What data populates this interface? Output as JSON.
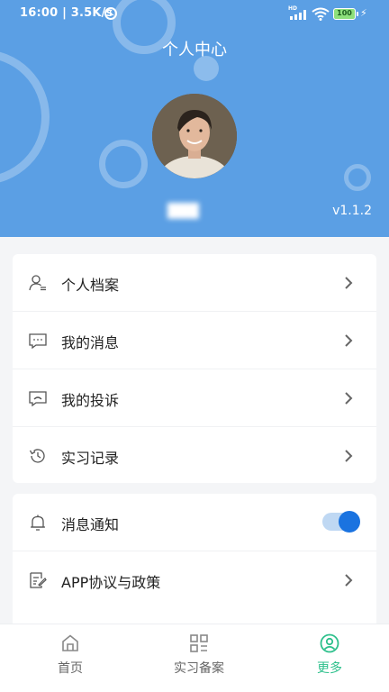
{
  "status_bar": {
    "time_speed": "16:00 | 3.5K/s",
    "network_badge": "HD",
    "battery_level": "100",
    "icons": [
      "alarm-icon",
      "signal-icon",
      "wifi-icon",
      "battery-icon",
      "charging-icon"
    ]
  },
  "header": {
    "title": "个人中心",
    "username": "███",
    "version": "v1.1.2",
    "background_color": "#5b9fe4"
  },
  "menu_group1": {
    "items": [
      {
        "label": "个人档案",
        "icon": "profile-icon"
      },
      {
        "label": "我的消息",
        "icon": "message-icon"
      },
      {
        "label": "我的投诉",
        "icon": "complaint-icon"
      },
      {
        "label": "实习记录",
        "icon": "history-icon"
      }
    ]
  },
  "menu_group2": {
    "notification": {
      "label": "消息通知",
      "icon": "bell-icon",
      "enabled": true
    },
    "agreement": {
      "label": "APP协议与政策",
      "icon": "document-icon"
    }
  },
  "tab_bar": {
    "tabs": [
      {
        "label": "首页",
        "icon": "home-icon",
        "active": false
      },
      {
        "label": "实习备案",
        "icon": "grid-icon",
        "active": false
      },
      {
        "label": "更多",
        "icon": "user-circle-icon",
        "active": true
      }
    ],
    "active_color": "#2ec08c"
  }
}
